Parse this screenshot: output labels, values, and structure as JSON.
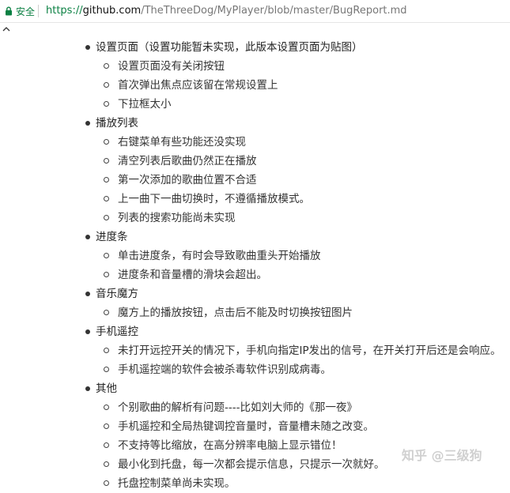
{
  "address_bar": {
    "secure_label": "安全",
    "url_scheme": "https://",
    "url_host": "github.com",
    "url_path": "/TheThreeDog/MyPlayer/blob/master/BugReport.md"
  },
  "colors": {
    "secure": "#0b8043",
    "text": "#222222",
    "border": "#e6e6e6"
  },
  "report": {
    "sections": [
      {
        "title": "设置页面（设置功能暂未实现，此版本设置页面为贴图）",
        "items": [
          "设置页面没有关闭按钮",
          "首次弹出焦点应该留在常规设置上",
          "下拉框太小"
        ]
      },
      {
        "title": "播放列表",
        "items": [
          "右键菜单有些功能还没实现",
          "清空列表后歌曲仍然正在播放",
          "第一次添加的歌曲位置不合适",
          "上一曲下一曲切换时，不遵循播放模式。",
          "列表的搜索功能尚未实现"
        ]
      },
      {
        "title": "进度条",
        "items": [
          "单击进度条，有时会导致歌曲重头开始播放",
          "进度条和音量槽的滑块会超出。"
        ]
      },
      {
        "title": "音乐魔方",
        "items": [
          "魔方上的播放按钮，点击后不能及时切换按钮图片"
        ]
      },
      {
        "title": "手机遥控",
        "items": [
          "未打开远控开关的情况下，手机向指定IP发出的信号，在开关打开后还是会响应。",
          "手机遥控端的软件会被杀毒软件识别成病毒。"
        ]
      },
      {
        "title": "其他",
        "items": [
          "个别歌曲的解析有问题----比如刘大师的《那一夜》",
          "手机遥控和全局热键调控音量时，音量槽未随之改变。",
          "不支持等比缩放，在高分辨率电脑上显示错位！",
          "最小化到托盘，每一次都会提示信息，只提示一次就好。",
          "托盘控制菜单尚未实现。"
        ]
      }
    ]
  },
  "watermark": {
    "text": "知乎 @三级狗"
  }
}
